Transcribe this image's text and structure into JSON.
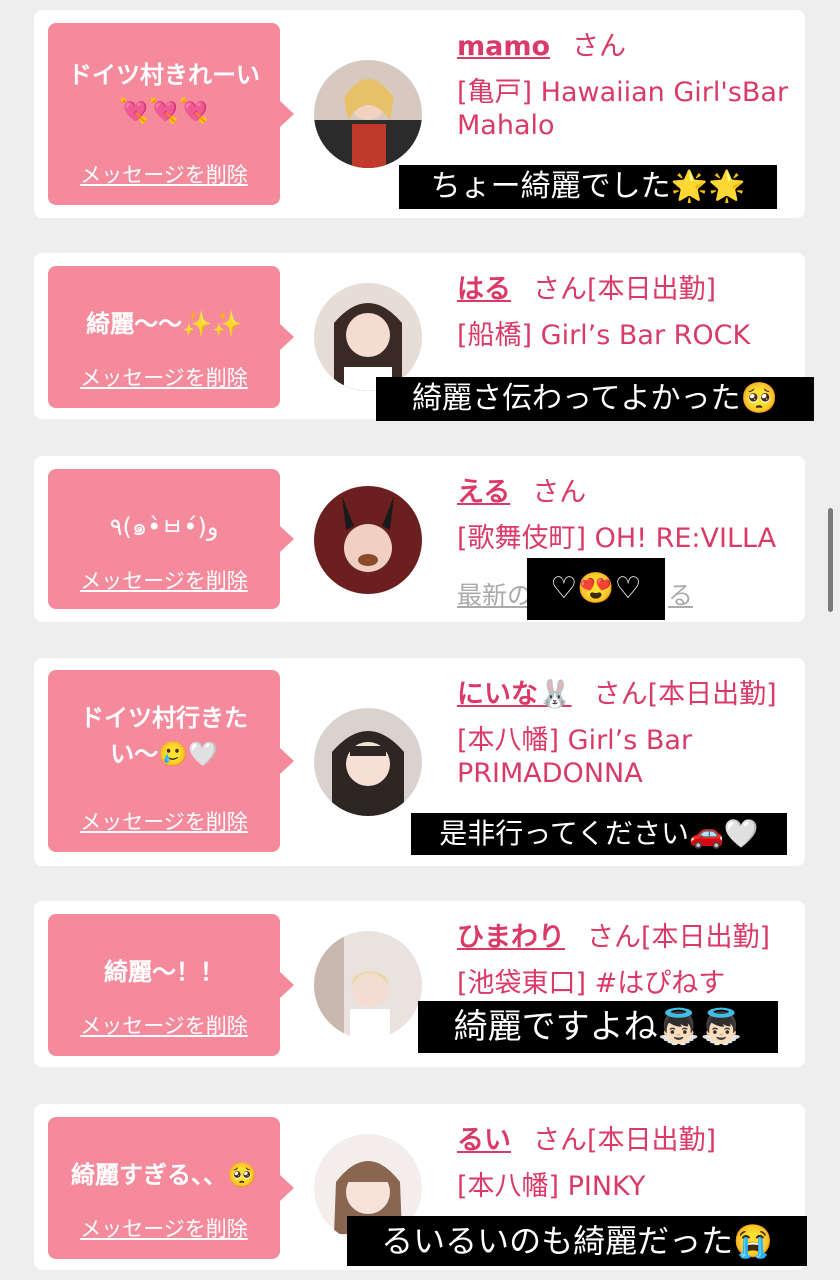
{
  "messages": [
    {
      "bubble_text": "ドイツ村きれーい💘💘💘",
      "delete_label": "メッセージを削除",
      "name": "mamo",
      "honorific": "さん",
      "shop_line1": "[亀戸] Hawaiian Girl'sBar",
      "shop_line2": "Mahalo",
      "caption": "ちょー綺麗でした🌟🌟"
    },
    {
      "bubble_text": "綺麗〜〜✨✨",
      "delete_label": "メッセージを削除",
      "name": "はる",
      "honorific": "さん[本日出勤]",
      "shop_line1": "[船橋] Girl’s Bar ROCK",
      "caption": "綺麗さ伝わってよかった🥺"
    },
    {
      "bubble_text": "٩(๑•̀ㅂ•́)و",
      "delete_label": "メッセージを削除",
      "name": "える",
      "honorific": "さん",
      "shop_line1": "[歌舞伎町] OH! RE:VILLA",
      "latest_link": "最新の",
      "latest_link_end": "る",
      "caption": "♡😍♡"
    },
    {
      "bubble_text": "ドイツ村行きたい〜🥲🤍",
      "delete_label": "メッセージを削除",
      "name": "にいな🐰",
      "honorific": "さん[本日出勤]",
      "shop_line1": "[本八幡] Girl’s Bar",
      "shop_line2": "PRIMADONNA",
      "caption": "是非行ってください🚗🤍"
    },
    {
      "bubble_text": "綺麗〜！！",
      "delete_label": "メッセージを削除",
      "name": "ひまわり",
      "honorific": "さん[本日出勤]",
      "shop_line1": "[池袋東口] #はぴねす",
      "caption": "綺麗ですよね👼🏻👼🏻"
    },
    {
      "bubble_text": "綺麗すぎる、、🥺",
      "delete_label": "メッセージを削除",
      "name": "るい",
      "honorific": "さん[本日出勤]",
      "shop_line1": "[本八幡] PINKY",
      "caption": "るいるいのも綺麗だった😭"
    }
  ],
  "colors": {
    "bubble": "#f48a9b",
    "accent_text": "#d93a67",
    "page_background": "#eeeeee"
  }
}
